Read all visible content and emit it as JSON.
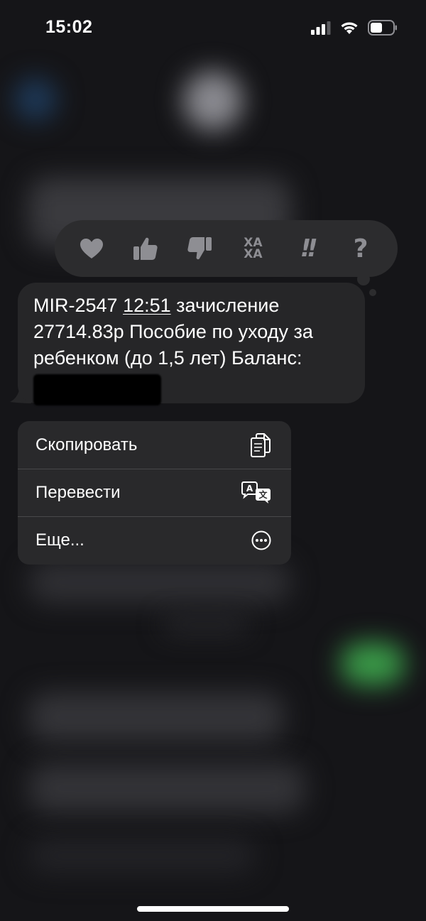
{
  "status_bar": {
    "time": "15:02"
  },
  "reactions": [
    {
      "name": "heart",
      "icon": "heart-icon"
    },
    {
      "name": "like",
      "icon": "thumbs-up-icon"
    },
    {
      "name": "dislike",
      "icon": "thumbs-down-icon"
    },
    {
      "name": "haha",
      "icon": "haha-icon",
      "label_top": "ХА",
      "label_bottom": "ХА"
    },
    {
      "name": "emphasize",
      "icon": "double-exclamation-icon",
      "label": "!!"
    },
    {
      "name": "question",
      "icon": "question-icon",
      "label": "?"
    }
  ],
  "message": {
    "sender_code": "MIR-2547",
    "time": "12:51",
    "text_after_time": "зачисление",
    "line2": "27714.83р Пособие по уходу за",
    "line3": "ребенком (до 1,5 лет) Баланс:"
  },
  "context_menu": {
    "items": [
      {
        "label": "Скопировать",
        "icon": "copy-icon"
      },
      {
        "label": "Перевести",
        "icon": "translate-icon"
      },
      {
        "label": "Еще...",
        "icon": "more-icon"
      }
    ]
  },
  "colors": {
    "background": "#151518",
    "reaction_bar": "#2c2c2e",
    "bubble": "#262628",
    "menu": "#29292b",
    "icon_gray": "#8e8e93",
    "separator": "#48484a"
  }
}
